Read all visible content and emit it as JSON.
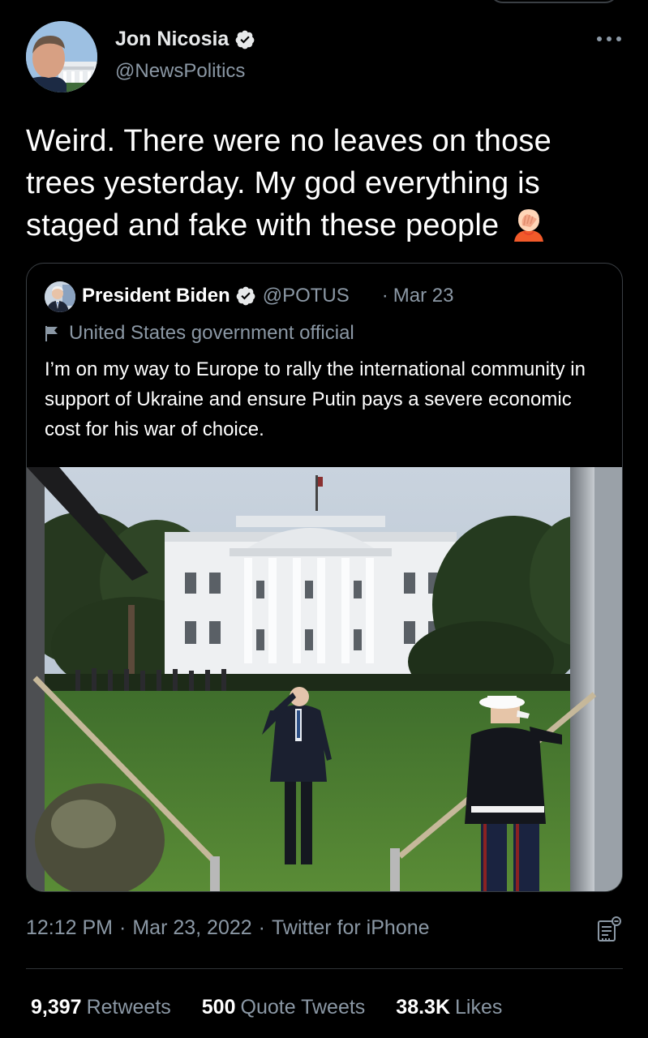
{
  "tweet": {
    "author_name": "Jon Nicosia",
    "author_handle": "@NewsPolitics",
    "text": "Weird.  There were no leaves on those trees yesterday. My god everything is staged and fake with these people",
    "emoji": "facepalm",
    "timestamp": "12:12 PM",
    "date": "Mar 23, 2022",
    "source": "Twitter for iPhone",
    "separator": "·"
  },
  "quote": {
    "author_name": "President Biden",
    "author_handle": "@POTUS",
    "separator": "·",
    "date": "Mar 23",
    "label": "United States government official",
    "text": "I’m on my way to Europe to rally the international community in support of Ukraine and ensure Putin pays a severe economic cost for his war of choice."
  },
  "stats": {
    "retweets_count": "9,397",
    "retweets_label": "Retweets",
    "quotes_count": "500",
    "quotes_label": "Quote Tweets",
    "likes_count": "38.3K",
    "likes_label": "Likes"
  },
  "icons": {
    "verified": "verified-badge-icon",
    "more": "more-options-icon",
    "flag": "flag-icon",
    "analytics": "tweet-analytics-icon"
  },
  "colors": {
    "background": "#000000",
    "text": "#e7e9ea",
    "muted": "#8b98a5",
    "border": "#3a3f44"
  }
}
